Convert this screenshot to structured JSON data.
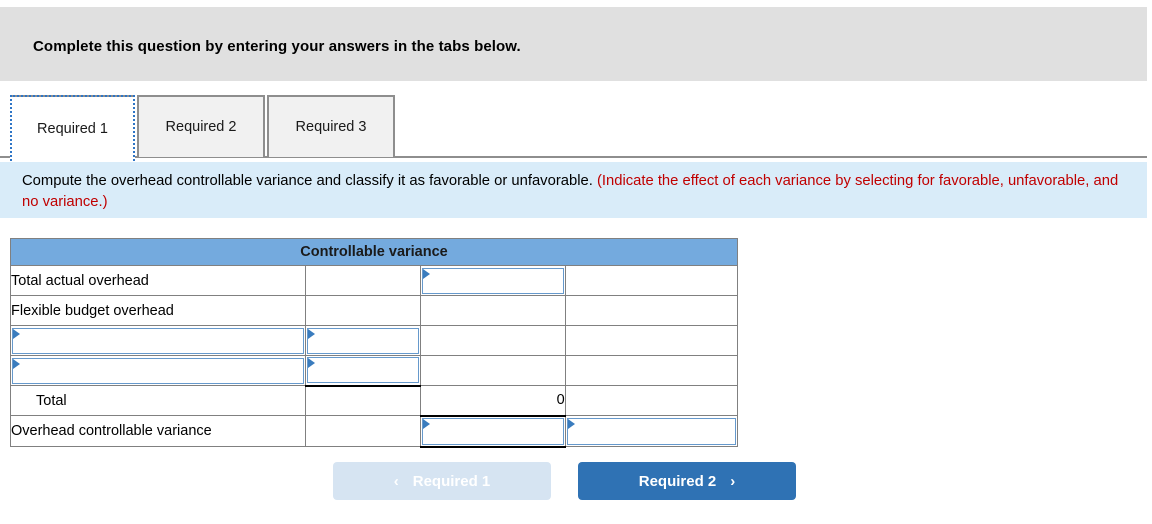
{
  "banner": {
    "text": "Complete this question by entering your answers in the tabs below."
  },
  "tabs": [
    {
      "label": "Required 1",
      "active": true
    },
    {
      "label": "Required 2",
      "active": false
    },
    {
      "label": "Required 3",
      "active": false
    }
  ],
  "instruction": {
    "black_part": "Compute the overhead controllable variance and classify it as favorable or unfavorable. ",
    "red_part": "(Indicate the effect of each variance by selecting for favorable, unfavorable, and no variance.)"
  },
  "table": {
    "header": "Controllable variance",
    "rows": [
      {
        "label": "Total actual overhead",
        "mid": "",
        "num": "",
        "num_field": true,
        "label_field": false,
        "mid_field": false,
        "classify_field": false
      },
      {
        "label": "Flexible budget overhead",
        "mid": "",
        "num": "",
        "num_field": false,
        "label_field": false,
        "mid_field": false,
        "classify_field": false
      },
      {
        "label": "",
        "mid": "",
        "num": "",
        "num_field": false,
        "label_field": true,
        "mid_field": true,
        "classify_field": false
      },
      {
        "label": "",
        "mid": "",
        "num": "",
        "num_field": false,
        "label_field": true,
        "mid_field": true,
        "classify_field": false
      },
      {
        "label": "Total",
        "mid": "",
        "num": "0",
        "num_field": false,
        "label_field": false,
        "mid_field": false,
        "classify_field": false
      },
      {
        "label": "Overhead controllable variance",
        "mid": "",
        "num": "",
        "num_field": true,
        "label_field": false,
        "mid_field": false,
        "classify_field": true
      }
    ]
  },
  "nav": {
    "prev_label": "Required 1",
    "next_label": "Required 2",
    "prev_chevron": "‹",
    "next_chevron": "›"
  },
  "colors": {
    "banner_bg": "#e0e0e0",
    "instruction_bg": "#d9ecf9",
    "table_header_bg": "#74aade",
    "accent_blue": "#2f72b4",
    "muted_blue": "#d6e4f2",
    "red_text": "#c00000"
  }
}
